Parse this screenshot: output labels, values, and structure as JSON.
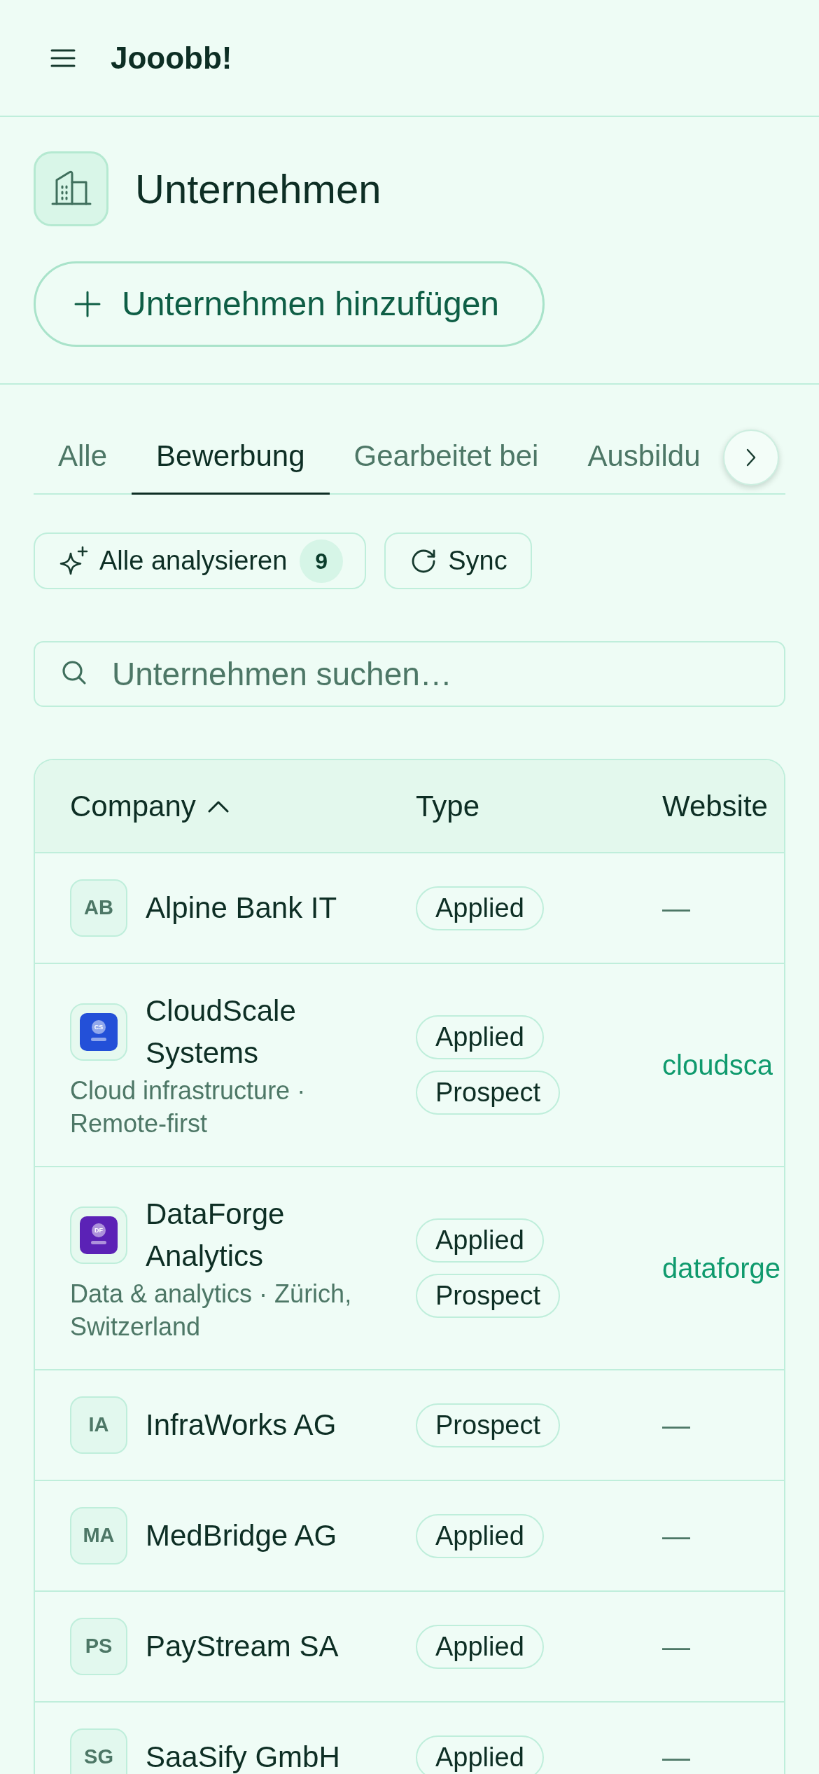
{
  "app_bar": {
    "title": "Jooobb!"
  },
  "header": {
    "title": "Unternehmen",
    "add_button": "Unternehmen hinzufügen"
  },
  "tabs": [
    {
      "label": "Alle",
      "selected": false
    },
    {
      "label": "Bewerbung",
      "selected": true
    },
    {
      "label": "Gearbeitet bei",
      "selected": false
    },
    {
      "label": "Ausbildu",
      "selected": false
    }
  ],
  "actions": [
    {
      "kind": "analyze",
      "label": "Alle analysieren",
      "count": "9"
    },
    {
      "kind": "sync",
      "label": "Sync"
    }
  ],
  "search": {
    "placeholder": "Unternehmen suchen…"
  },
  "table": {
    "columns": [
      {
        "label": "Company",
        "sorted": true
      },
      {
        "label": "Type",
        "sorted": false
      },
      {
        "label": "Website",
        "sorted": false
      }
    ],
    "rows": [
      {
        "name": "Alpine Bank IT",
        "logo": {
          "kind": "initials",
          "text": "AB"
        },
        "types": [
          "Applied"
        ],
        "website": {
          "kind": "empty",
          "text": "—"
        }
      },
      {
        "name": "CloudScale Systems",
        "description": "Cloud infrastructure · Remote-first",
        "logo": {
          "kind": "image",
          "text": "CS",
          "color": "#2350d8"
        },
        "types": [
          "Applied",
          "Prospect"
        ],
        "website": {
          "kind": "link",
          "text": "cloudsca"
        }
      },
      {
        "name": "DataForge Analytics",
        "description": "Data & analytics · Zürich, Switzerland",
        "logo": {
          "kind": "image",
          "text": "DF",
          "color": "#5b22b6"
        },
        "types": [
          "Applied",
          "Prospect"
        ],
        "website": {
          "kind": "link",
          "text": "dataforge"
        }
      },
      {
        "name": "InfraWorks AG",
        "logo": {
          "kind": "initials",
          "text": "IA"
        },
        "types": [
          "Prospect"
        ],
        "website": {
          "kind": "empty",
          "text": "—"
        }
      },
      {
        "name": "MedBridge AG",
        "logo": {
          "kind": "initials",
          "text": "MA"
        },
        "types": [
          "Applied"
        ],
        "website": {
          "kind": "empty",
          "text": "—"
        }
      },
      {
        "name": "PayStream SA",
        "logo": {
          "kind": "initials",
          "text": "PS"
        },
        "types": [
          "Applied"
        ],
        "website": {
          "kind": "empty",
          "text": "—"
        }
      },
      {
        "name": "SaaSify GmbH",
        "logo": {
          "kind": "initials",
          "text": "SG"
        },
        "types": [
          "Applied"
        ],
        "website": {
          "kind": "empty",
          "text": "—"
        }
      }
    ]
  }
}
